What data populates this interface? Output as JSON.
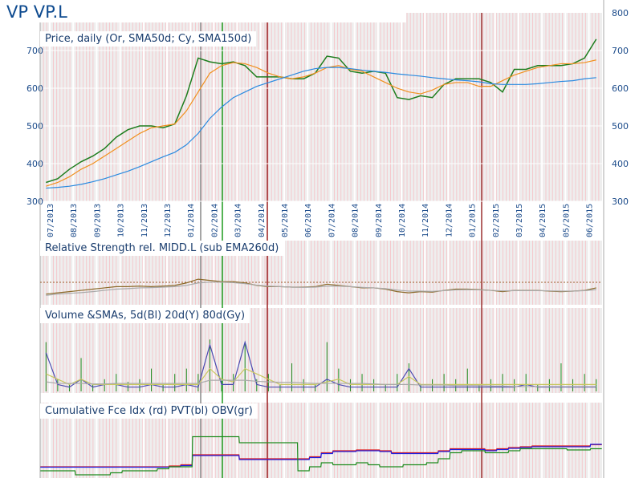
{
  "header": {
    "title": "VP VP.L"
  },
  "chart_data": [
    {
      "type": "line",
      "title": "Price, daily (Or, SMA50d; Cy, SMA150d)",
      "ylim": [
        300,
        800
      ],
      "yticks_left": [
        300,
        400,
        500,
        600,
        700
      ],
      "yticks_right": [
        300,
        400,
        500,
        600,
        700,
        800
      ],
      "x": [
        "07/2013",
        "08/2013",
        "09/2013",
        "10/2013",
        "11/2013",
        "12/2013",
        "01/2014",
        "02/2014",
        "03/2014",
        "04/2014",
        "05/2014",
        "06/2014",
        "07/2014",
        "08/2014",
        "09/2014",
        "10/2014",
        "11/2014",
        "12/2014",
        "01/2015",
        "02/2015",
        "03/2015",
        "04/2015",
        "05/2015",
        "06/2015"
      ],
      "series": [
        {
          "name": "Price",
          "color": "#1e7d1e",
          "values": [
            350,
            360,
            385,
            405,
            420,
            440,
            470,
            490,
            500,
            500,
            495,
            505,
            580,
            680,
            670,
            665,
            670,
            660,
            630,
            630,
            630,
            625,
            625,
            640,
            685,
            680,
            645,
            640,
            645,
            640,
            575,
            570,
            580,
            575,
            610,
            625,
            625,
            625,
            615,
            590,
            650,
            650,
            660,
            660,
            660,
            665,
            680,
            730
          ]
        },
        {
          "name": "SMA50d",
          "color": "#f0901e",
          "values": [
            340,
            350,
            365,
            385,
            400,
            420,
            440,
            460,
            480,
            495,
            500,
            505,
            540,
            590,
            640,
            660,
            668,
            665,
            655,
            640,
            630,
            625,
            630,
            640,
            655,
            660,
            650,
            645,
            630,
            615,
            600,
            590,
            585,
            595,
            610,
            615,
            615,
            605,
            605,
            620,
            635,
            645,
            655,
            660,
            665,
            665,
            668,
            675
          ]
        },
        {
          "name": "SMA150d",
          "color": "#2a8ae0",
          "values": [
            335,
            337,
            340,
            345,
            352,
            360,
            370,
            380,
            392,
            405,
            418,
            430,
            450,
            480,
            520,
            550,
            575,
            590,
            605,
            615,
            625,
            635,
            645,
            652,
            655,
            655,
            652,
            648,
            645,
            642,
            638,
            635,
            632,
            628,
            625,
            622,
            620,
            617,
            612,
            610,
            610,
            610,
            612,
            615,
            618,
            620,
            625,
            628
          ]
        }
      ]
    },
    {
      "type": "line",
      "title": "Relative Strength rel. MIDD.L (sub EMA260d)",
      "series": [
        {
          "name": "RS",
          "color": "#8b6a2a",
          "values": [
            0.3,
            0.35,
            0.4,
            0.45,
            0.5,
            0.55,
            0.6,
            0.6,
            0.62,
            0.6,
            0.62,
            0.65,
            0.75,
            0.9,
            0.85,
            0.8,
            0.8,
            0.75,
            0.65,
            0.6,
            0.6,
            0.58,
            0.58,
            0.6,
            0.7,
            0.65,
            0.6,
            0.55,
            0.55,
            0.5,
            0.4,
            0.35,
            0.4,
            0.38,
            0.45,
            0.5,
            0.5,
            0.48,
            0.45,
            0.4,
            0.45,
            0.45,
            0.45,
            0.42,
            0.4,
            0.42,
            0.45,
            0.55
          ]
        },
        {
          "name": "EMA260d",
          "color": "#aaaaaa",
          "values": [
            0.25,
            0.3,
            0.33,
            0.36,
            0.4,
            0.45,
            0.5,
            0.52,
            0.55,
            0.56,
            0.58,
            0.6,
            0.65,
            0.75,
            0.78,
            0.78,
            0.76,
            0.72,
            0.66,
            0.62,
            0.6,
            0.58,
            0.57,
            0.58,
            0.62,
            0.62,
            0.6,
            0.57,
            0.55,
            0.52,
            0.46,
            0.42,
            0.42,
            0.41,
            0.44,
            0.47,
            0.48,
            0.47,
            0.45,
            0.43,
            0.44,
            0.44,
            0.44,
            0.43,
            0.42,
            0.42,
            0.44,
            0.48
          ]
        }
      ]
    },
    {
      "type": "line",
      "title": "Volume &SMAs, 5d(Bl) 20d(Y) 80d(Gy)",
      "series": [
        {
          "name": "Volume",
          "color": "#1e8c1e",
          "values": [
            0.9,
            0.2,
            0.1,
            0.6,
            0.1,
            0.2,
            0.3,
            0.15,
            0.2,
            0.4,
            0.1,
            0.3,
            0.4,
            0.3,
            0.95,
            0.2,
            0.3,
            0.9,
            0.2,
            0.3,
            0.1,
            0.5,
            0.2,
            0.1,
            0.9,
            0.4,
            0.2,
            0.3,
            0.2,
            0.1,
            0.3,
            0.5,
            0.1,
            0.2,
            0.3,
            0.2,
            0.4,
            0.1,
            0.2,
            0.3,
            0.2,
            0.3,
            0.1,
            0.2,
            0.5,
            0.2,
            0.3,
            0.2
          ]
        },
        {
          "name": "5d",
          "color": "#4a4ab0",
          "values": [
            0.7,
            0.1,
            0.05,
            0.2,
            0.05,
            0.1,
            0.1,
            0.05,
            0.05,
            0.1,
            0.05,
            0.05,
            0.1,
            0.05,
            0.85,
            0.1,
            0.1,
            0.9,
            0.1,
            0.05,
            0.05,
            0.05,
            0.05,
            0.05,
            0.2,
            0.1,
            0.05,
            0.05,
            0.05,
            0.05,
            0.05,
            0.4,
            0.05,
            0.05,
            0.05,
            0.05,
            0.05,
            0.05,
            0.05,
            0.05,
            0.05,
            0.1,
            0.05,
            0.05,
            0.05,
            0.05,
            0.05,
            0.05
          ]
        },
        {
          "name": "20d",
          "color": "#c8c860",
          "values": [
            0.3,
            0.2,
            0.1,
            0.2,
            0.1,
            0.1,
            0.1,
            0.1,
            0.1,
            0.1,
            0.1,
            0.1,
            0.1,
            0.1,
            0.4,
            0.2,
            0.15,
            0.4,
            0.3,
            0.2,
            0.1,
            0.1,
            0.1,
            0.1,
            0.15,
            0.2,
            0.1,
            0.1,
            0.1,
            0.1,
            0.1,
            0.25,
            0.1,
            0.1,
            0.1,
            0.1,
            0.1,
            0.1,
            0.1,
            0.1,
            0.1,
            0.1,
            0.1,
            0.1,
            0.1,
            0.1,
            0.1,
            0.1
          ]
        },
        {
          "name": "80d",
          "color": "#aaaaaa",
          "values": [
            0.15,
            0.12,
            0.12,
            0.12,
            0.11,
            0.11,
            0.12,
            0.12,
            0.12,
            0.12,
            0.12,
            0.12,
            0.12,
            0.12,
            0.18,
            0.18,
            0.18,
            0.18,
            0.16,
            0.15,
            0.14,
            0.14,
            0.13,
            0.12,
            0.12,
            0.12,
            0.12,
            0.12,
            0.11,
            0.1,
            0.1,
            0.1,
            0.09,
            0.09,
            0.09,
            0.08,
            0.08,
            0.08,
            0.07,
            0.07,
            0.06,
            0.06,
            0.06,
            0.06,
            0.06,
            0.06,
            0.06,
            0.06
          ]
        }
      ]
    },
    {
      "type": "line",
      "title": "Cumulative Fce Idx (rd) PVT(bl) OBV(gr)",
      "series": [
        {
          "name": "Force Index",
          "color": "#e02020",
          "values": [
            0.2,
            0.2,
            0.2,
            0.2,
            0.2,
            0.2,
            0.2,
            0.2,
            0.2,
            0.2,
            0.2,
            0.22,
            0.25,
            0.5,
            0.5,
            0.5,
            0.5,
            0.4,
            0.4,
            0.4,
            0.4,
            0.4,
            0.4,
            0.45,
            0.55,
            0.6,
            0.6,
            0.62,
            0.62,
            0.6,
            0.55,
            0.55,
            0.55,
            0.55,
            0.6,
            0.65,
            0.65,
            0.65,
            0.62,
            0.65,
            0.68,
            0.7,
            0.72,
            0.72,
            0.72,
            0.72,
            0.72,
            0.75
          ]
        },
        {
          "name": "PVT",
          "color": "#2020e0",
          "values": [
            0.19,
            0.19,
            0.19,
            0.19,
            0.19,
            0.19,
            0.19,
            0.19,
            0.19,
            0.19,
            0.19,
            0.2,
            0.23,
            0.48,
            0.48,
            0.48,
            0.48,
            0.38,
            0.38,
            0.38,
            0.38,
            0.38,
            0.38,
            0.43,
            0.53,
            0.58,
            0.58,
            0.6,
            0.6,
            0.58,
            0.53,
            0.53,
            0.53,
            0.53,
            0.58,
            0.63,
            0.63,
            0.63,
            0.6,
            0.63,
            0.66,
            0.68,
            0.7,
            0.7,
            0.7,
            0.7,
            0.7,
            0.76
          ]
        },
        {
          "name": "OBV",
          "color": "#1e8c1e",
          "values": [
            0.1,
            0.1,
            0.1,
            0.0,
            0.0,
            0.0,
            0.05,
            0.1,
            0.1,
            0.1,
            0.15,
            0.2,
            0.2,
            0.95,
            0.95,
            0.95,
            0.95,
            0.8,
            0.8,
            0.8,
            0.8,
            0.8,
            0.1,
            0.2,
            0.3,
            0.25,
            0.25,
            0.3,
            0.25,
            0.2,
            0.2,
            0.25,
            0.25,
            0.3,
            0.4,
            0.55,
            0.6,
            0.6,
            0.55,
            0.55,
            0.6,
            0.65,
            0.65,
            0.65,
            0.65,
            0.62,
            0.62,
            0.65
          ]
        }
      ]
    }
  ]
}
